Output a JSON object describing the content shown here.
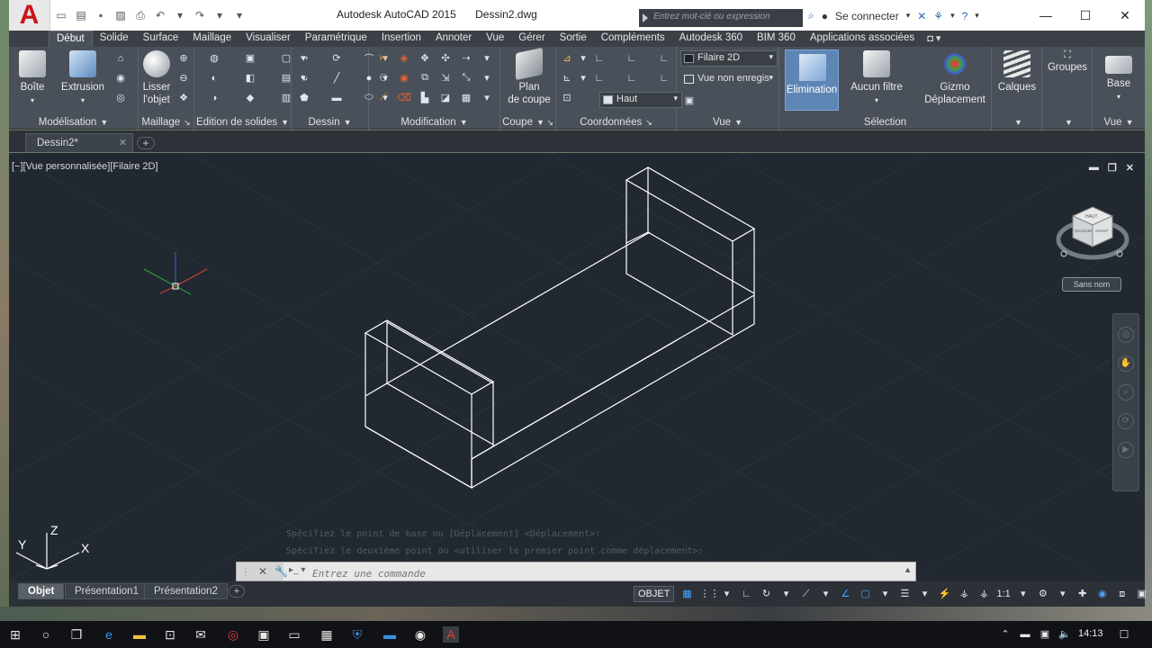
{
  "titlebar": {
    "app_name": "Autodesk AutoCAD 2015",
    "file_name": "Dessin2.dwg",
    "search_placeholder": "Entrez mot-clé ou expression",
    "sign_in": "Se connecter"
  },
  "ribbon_tabs": [
    "Début",
    "Solide",
    "Surface",
    "Maillage",
    "Visualiser",
    "Paramétrique",
    "Insertion",
    "Annoter",
    "Vue",
    "Gérer",
    "Sortie",
    "Compléments",
    "Autodesk 360",
    "BIM 360",
    "Applications associées"
  ],
  "panels": {
    "modelisation": {
      "title": "Modélisation",
      "boite": "Boîte",
      "extrusion": "Extrusion"
    },
    "maillage": {
      "title": "Maillage",
      "lisser_line1": "Lisser",
      "lisser_line2": "l'objet"
    },
    "edition": {
      "title": "Edition de solides"
    },
    "dessin": {
      "title": "Dessin"
    },
    "modification": {
      "title": "Modification"
    },
    "coupe": {
      "title": "Coupe",
      "plan_line1": "Plan",
      "plan_line2": "de coupe"
    },
    "coordonnees": {
      "title": "Coordonnées",
      "ucs_value": "Haut"
    },
    "vue": {
      "title": "Vue",
      "visual_style": "Filaire 2D",
      "view_name": "Vue non enregis"
    },
    "selection": {
      "title": "Sélection",
      "elimination": "Elimination",
      "aucun_filtre": "Aucun filtre",
      "gizmo_line1": "Gizmo",
      "gizmo_line2": "Déplacement"
    },
    "calques": {
      "title": "Calques"
    },
    "groupes": {
      "title": "Groupes"
    },
    "base": {
      "title": "Base",
      "vue_label": "Vue"
    }
  },
  "file_tab": "Dessin2*",
  "viewport": {
    "label": "[−][Vue personnalisée][Filaire 2D]",
    "view_style_name": "Sans nom",
    "axis_labels": {
      "x": "X",
      "y": "Y",
      "z": "Z"
    },
    "viewcube_faces": {
      "top": "HAUT",
      "front": "AVANT",
      "left": "GAUCHE"
    }
  },
  "command": {
    "history": [
      "Spécifiez le point de base ou [Déplacement] <Déplacement>:",
      "Spécifiez le deuxième point ou <utiliser le premier point comme déplacement>:"
    ],
    "placeholder": "Entrez une commande"
  },
  "layout_tabs": [
    "Objet",
    "Présentation1",
    "Présentation2"
  ],
  "status": {
    "model": "OBJET",
    "scale": "1:1"
  },
  "taskbar": {
    "time": "14:13"
  },
  "colors": {
    "ribbon_bg": "#4a5059",
    "viewport_bg": "#212830",
    "accent": "#5e86b5",
    "logo_red": "#c8141c"
  }
}
